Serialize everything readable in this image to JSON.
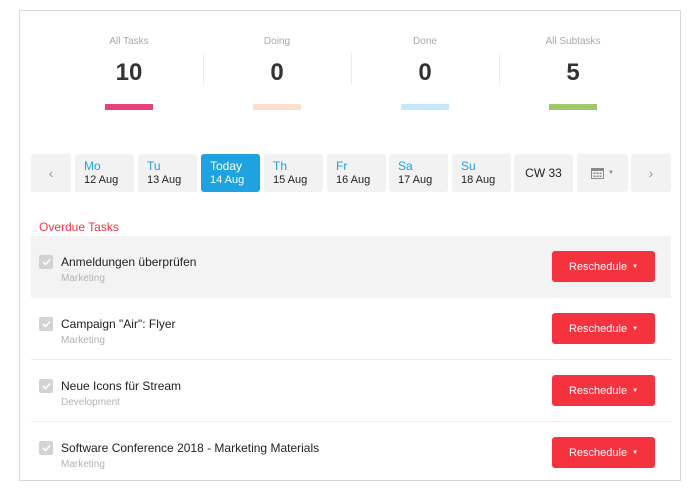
{
  "stats": [
    {
      "label": "All Tasks",
      "value": "10",
      "color": "#e8407a"
    },
    {
      "label": "Doing",
      "value": "0",
      "color": "#fde0cc"
    },
    {
      "label": "Done",
      "value": "0",
      "color": "#c4e9f9"
    },
    {
      "label": "All Subtasks",
      "value": "5",
      "color": "#9dc96b"
    }
  ],
  "datebar": {
    "prev_icon": "chevron-left-icon",
    "next_icon": "chevron-right-icon",
    "days": [
      {
        "name": "Mo",
        "date": "12 Aug",
        "active": false
      },
      {
        "name": "Tu",
        "date": "13 Aug",
        "active": false
      },
      {
        "name": "Today",
        "date": "14 Aug",
        "active": true
      },
      {
        "name": "Th",
        "date": "15 Aug",
        "active": false
      },
      {
        "name": "Fr",
        "date": "16 Aug",
        "active": false
      },
      {
        "name": "Sa",
        "date": "17 Aug",
        "active": false
      },
      {
        "name": "Su",
        "date": "18 Aug",
        "active": false
      }
    ],
    "week_label": "CW 33",
    "calendar_icon": "calendar-icon",
    "active_color": "#1ea3e0"
  },
  "overdue": {
    "title": "Overdue Tasks",
    "accent": "#f0353f",
    "button_label": "Reschedule",
    "tasks": [
      {
        "title": "Anmeldungen überprüfen",
        "category": "Marketing"
      },
      {
        "title": "Campaign \"Air\": Flyer",
        "category": "Marketing"
      },
      {
        "title": "Neue Icons für Stream",
        "category": "Development"
      },
      {
        "title": "Software Conference 2018 - Marketing Materials",
        "category": "Marketing"
      }
    ]
  }
}
